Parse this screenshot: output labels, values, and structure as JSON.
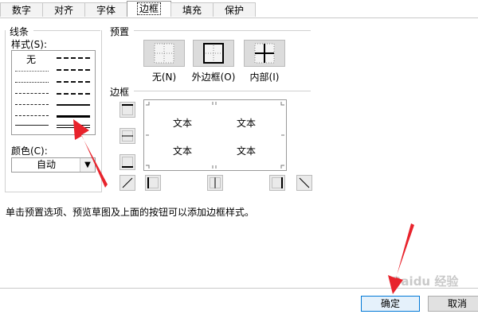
{
  "tabs": [
    {
      "label": "数字"
    },
    {
      "label": "对齐"
    },
    {
      "label": "字体"
    },
    {
      "label": "边框",
      "active": true
    },
    {
      "label": "填充"
    },
    {
      "label": "保护"
    }
  ],
  "line_group": {
    "title": "线条",
    "style_label": "样式(S):",
    "none_label": "无",
    "color_label": "颜色(C):",
    "color_value": "自动"
  },
  "preset_group": {
    "title": "预置",
    "buttons": [
      {
        "label": "无(N)",
        "icon": "border-none-icon"
      },
      {
        "label": "外边框(O)",
        "icon": "border-outline-icon"
      },
      {
        "label": "内部(I)",
        "icon": "border-inside-icon"
      }
    ]
  },
  "border_group": {
    "title": "边框",
    "preview_text": [
      "文本",
      "文本",
      "文本",
      "文本"
    ]
  },
  "hint": "单击预置选项、预览草图及上面的按钮可以添加边框样式。",
  "footer": {
    "ok_label": "确定",
    "cancel_label": "取消"
  },
  "watermark": "Baidu 经验",
  "colors": {
    "annotation_arrow": "#e8232c",
    "ok_border": "#0078d7"
  }
}
